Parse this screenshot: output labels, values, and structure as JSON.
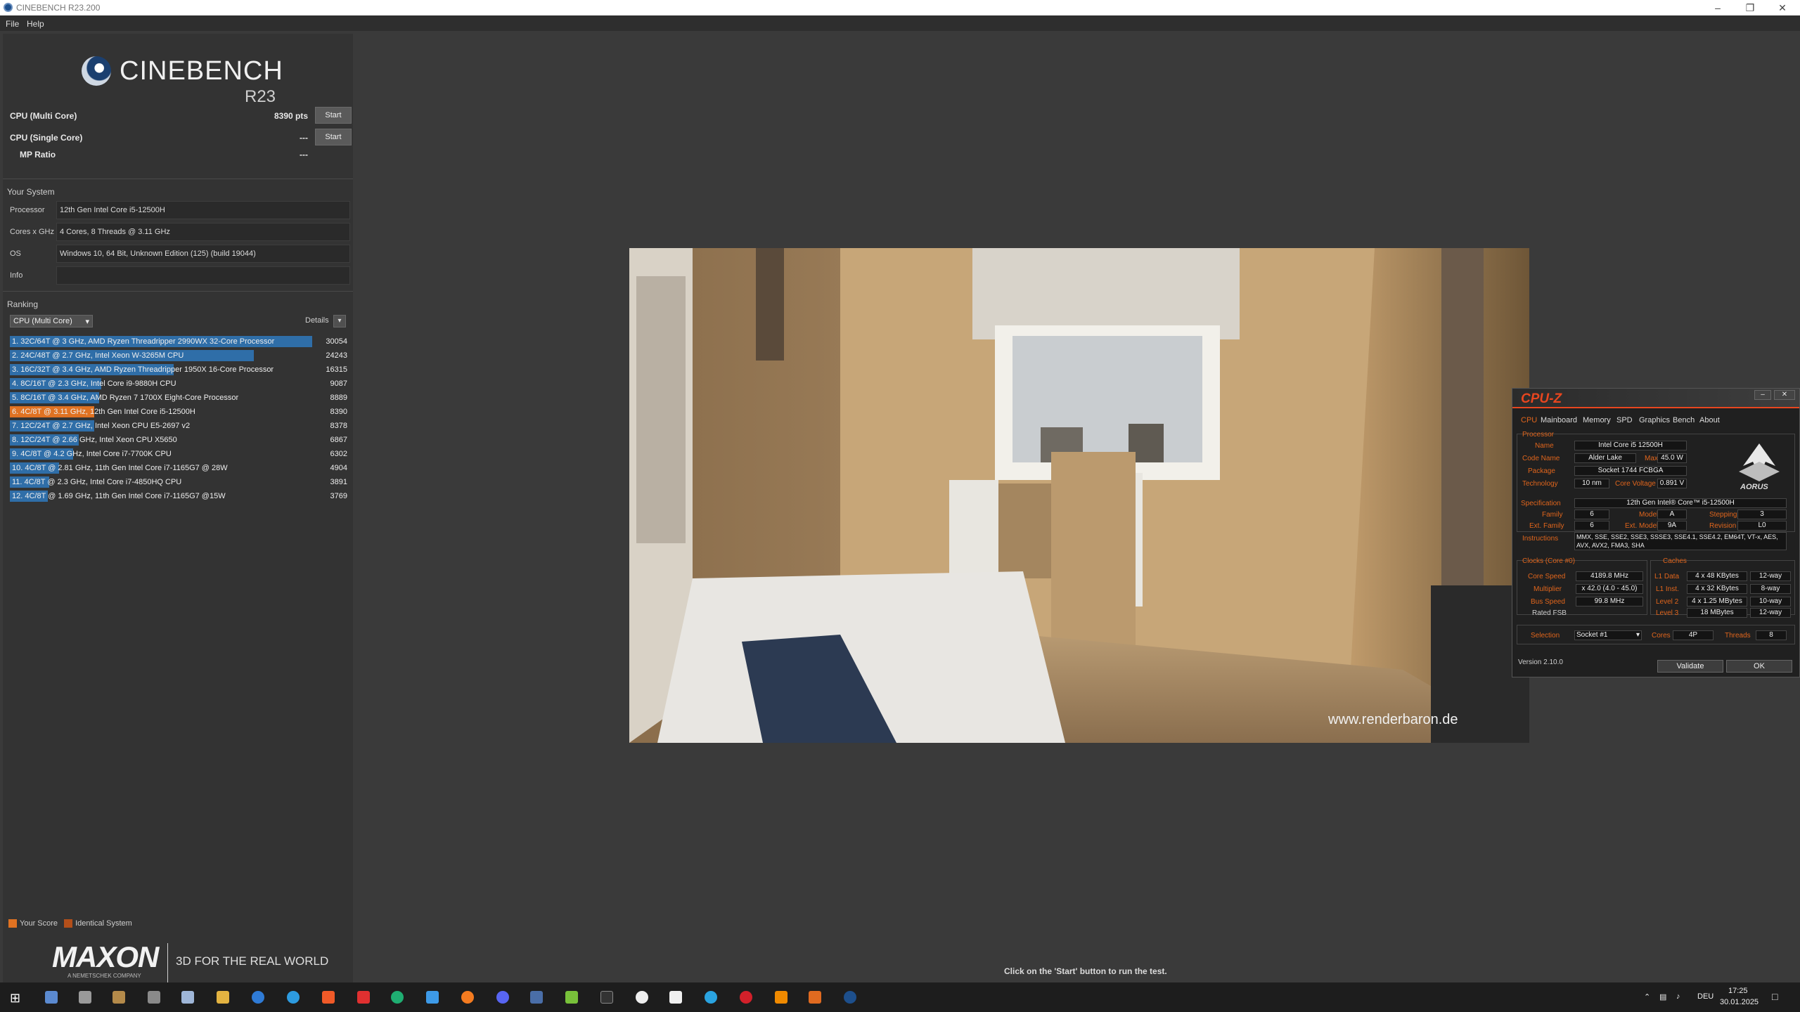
{
  "window": {
    "title": "CINEBENCH R23.200"
  },
  "menu": {
    "file": "File",
    "help": "Help"
  },
  "logo": {
    "name": "CINEBENCH",
    "version": "R23"
  },
  "scores": {
    "multi_label": "CPU (Multi Core)",
    "multi_value": "8390 pts",
    "single_label": "CPU (Single Core)",
    "single_value": "---",
    "mp_label": "MP Ratio",
    "mp_value": "---",
    "start_label": "Start"
  },
  "system": {
    "title": "Your System",
    "rows": [
      {
        "k": "Processor",
        "v": "12th Gen Intel Core i5-12500H"
      },
      {
        "k": "Cores x GHz",
        "v": "4 Cores, 8 Threads @ 3.11 GHz"
      },
      {
        "k": "OS",
        "v": "Windows 10, 64 Bit, Unknown Edition (125) (build 19044)"
      },
      {
        "k": "Info",
        "v": ""
      }
    ]
  },
  "ranking": {
    "title": "Ranking",
    "dropdown": "CPU (Multi Core)",
    "details": "Details",
    "max_score": 30054,
    "rows": [
      {
        "label": "1. 32C/64T @ 3 GHz, AMD Ryzen Threadripper 2990WX 32-Core Processor",
        "score": 30054,
        "you": false
      },
      {
        "label": "2. 24C/48T @ 2.7 GHz, Intel Xeon W-3265M CPU",
        "score": 24243,
        "you": false
      },
      {
        "label": "3. 16C/32T @ 3.4 GHz, AMD Ryzen Threadripper 1950X 16-Core Processor",
        "score": 16315,
        "you": false
      },
      {
        "label": "4. 8C/16T @ 2.3 GHz, Intel Core i9-9880H CPU",
        "score": 9087,
        "you": false
      },
      {
        "label": "5. 8C/16T @ 3.4 GHz, AMD Ryzen 7 1700X Eight-Core Processor",
        "score": 8889,
        "you": false
      },
      {
        "label": "6. 4C/8T @ 3.11 GHz, 12th Gen Intel Core i5-12500H",
        "score": 8390,
        "you": true
      },
      {
        "label": "7. 12C/24T @ 2.7 GHz, Intel Xeon CPU E5-2697 v2",
        "score": 8378,
        "you": false
      },
      {
        "label": "8. 12C/24T @ 2.66 GHz, Intel Xeon CPU X5650",
        "score": 6867,
        "you": false
      },
      {
        "label": "9. 4C/8T @ 4.2 GHz, Intel Core i7-7700K CPU",
        "score": 6302,
        "you": false
      },
      {
        "label": "10. 4C/8T @ 2.81 GHz, 11th Gen Intel Core i7-1165G7 @ 28W",
        "score": 4904,
        "you": false
      },
      {
        "label": "11. 4C/8T @ 2.3 GHz, Intel Core i7-4850HQ CPU",
        "score": 3891,
        "you": false
      },
      {
        "label": "12. 4C/8T @ 1.69 GHz, 11th Gen Intel Core i7-1165G7 @15W",
        "score": 3769,
        "you": false
      }
    ]
  },
  "legend": {
    "your_score": "Your Score",
    "identical": "Identical System",
    "your_color": "#e07222",
    "identical_color": "#b34f1a"
  },
  "maxon": {
    "word": "MAXON",
    "sub": "A NEMETSCHEK COMPANY",
    "tagline": "3D FOR THE REAL WORLD"
  },
  "render": {
    "watermark": "www.renderbaron.de"
  },
  "status": "Click on the 'Start' button to run the test.",
  "cpuz": {
    "title": "CPU-Z",
    "tabs": [
      "CPU",
      "Mainboard",
      "Memory",
      "SPD",
      "Graphics",
      "Bench",
      "About"
    ],
    "processor_group": "Processor",
    "name_label": "Name",
    "name": "Intel Core i5 12500H",
    "code_label": "Code Name",
    "code": "Alder Lake",
    "tdp_label": "Max TDP",
    "tdp": "45.0 W",
    "package_label": "Package",
    "package": "Socket 1744 FCBGA",
    "tech_label": "Technology",
    "tech": "10 nm",
    "volt_label": "Core Voltage",
    "volt": "0.891 V",
    "spec_label": "Specification",
    "spec": "12th Gen Intel® Core™ i5-12500H",
    "family_label": "Family",
    "family": "6",
    "model_label": "Model",
    "model": "A",
    "stepping_label": "Stepping",
    "stepping": "3",
    "extfam_label": "Ext. Family",
    "extfam": "6",
    "extmodel_label": "Ext. Model",
    "extmodel": "9A",
    "revision_label": "Revision",
    "revision": "L0",
    "instr_label": "Instructions",
    "instr": "MMX, SSE, SSE2, SSE3, SSSE3, SSE4.1, SSE4.2, EM64T, VT-x, AES, AVX, AVX2, FMA3, SHA",
    "clocks_group": "Clocks (Core #0)",
    "speed_label": "Core Speed",
    "speed": "4189.8 MHz",
    "mult_label": "Multiplier",
    "mult": "x 42.0 (4.0 - 45.0)",
    "bus_label": "Bus Speed",
    "bus": "99.8 MHz",
    "fsb_label": "Rated FSB",
    "fsb": "",
    "caches_group": "Caches",
    "l1d_label": "L1 Data",
    "l1d": "4 x 48 KBytes",
    "l1d_way": "12-way",
    "l1i_label": "L1 Inst.",
    "l1i": "4 x 32 KBytes",
    "l1i_way": "8-way",
    "l2_label": "Level 2",
    "l2": "4 x 1.25 MBytes",
    "l2_way": "10-way",
    "l3_label": "Level 3",
    "l3": "18 MBytes",
    "l3_way": "12-way",
    "sel_label": "Selection",
    "sel": "Socket #1",
    "cores_label": "Cores",
    "cores": "4P",
    "threads_label": "Threads",
    "threads": "8",
    "version": "Version 2.10.0",
    "validate": "Validate",
    "ok": "OK",
    "brand": "AORUS"
  },
  "tray": {
    "lang": "DEU",
    "time": "17:25",
    "date": "30.01.2025"
  }
}
